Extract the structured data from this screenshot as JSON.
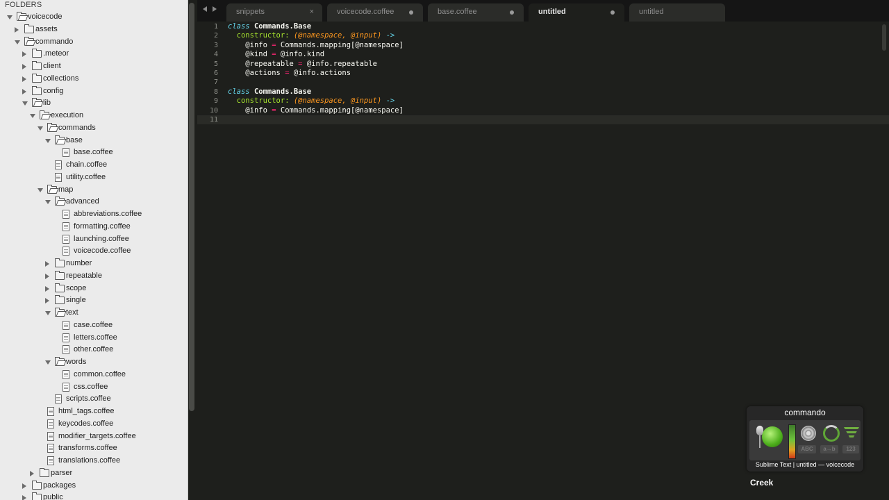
{
  "sidebar": {
    "header": "FOLDERS",
    "tree": [
      {
        "label": "voicecode",
        "depth": 0,
        "kind": "folder",
        "open": true
      },
      {
        "label": "assets",
        "depth": 1,
        "kind": "folder",
        "open": false
      },
      {
        "label": "commando",
        "depth": 1,
        "kind": "folder",
        "open": true
      },
      {
        "label": ".meteor",
        "depth": 2,
        "kind": "folder",
        "open": false
      },
      {
        "label": "client",
        "depth": 2,
        "kind": "folder",
        "open": false
      },
      {
        "label": "collections",
        "depth": 2,
        "kind": "folder",
        "open": false
      },
      {
        "label": "config",
        "depth": 2,
        "kind": "folder",
        "open": false
      },
      {
        "label": "lib",
        "depth": 2,
        "kind": "folder",
        "open": true
      },
      {
        "label": "execution",
        "depth": 3,
        "kind": "folder",
        "open": true
      },
      {
        "label": "commands",
        "depth": 4,
        "kind": "folder",
        "open": true
      },
      {
        "label": "base",
        "depth": 5,
        "kind": "folder",
        "open": true
      },
      {
        "label": "base.coffee",
        "depth": 6,
        "kind": "file"
      },
      {
        "label": "chain.coffee",
        "depth": 5,
        "kind": "file"
      },
      {
        "label": "utility.coffee",
        "depth": 5,
        "kind": "file"
      },
      {
        "label": "map",
        "depth": 4,
        "kind": "folder",
        "open": true
      },
      {
        "label": "advanced",
        "depth": 5,
        "kind": "folder",
        "open": true
      },
      {
        "label": "abbreviations.coffee",
        "depth": 6,
        "kind": "file"
      },
      {
        "label": "formatting.coffee",
        "depth": 6,
        "kind": "file"
      },
      {
        "label": "launching.coffee",
        "depth": 6,
        "kind": "file"
      },
      {
        "label": "voicecode.coffee",
        "depth": 6,
        "kind": "file"
      },
      {
        "label": "number",
        "depth": 5,
        "kind": "folder",
        "open": false
      },
      {
        "label": "repeatable",
        "depth": 5,
        "kind": "folder",
        "open": false
      },
      {
        "label": "scope",
        "depth": 5,
        "kind": "folder",
        "open": false
      },
      {
        "label": "single",
        "depth": 5,
        "kind": "folder",
        "open": false
      },
      {
        "label": "text",
        "depth": 5,
        "kind": "folder",
        "open": true
      },
      {
        "label": "case.coffee",
        "depth": 6,
        "kind": "file"
      },
      {
        "label": "letters.coffee",
        "depth": 6,
        "kind": "file"
      },
      {
        "label": "other.coffee",
        "depth": 6,
        "kind": "file"
      },
      {
        "label": "words",
        "depth": 5,
        "kind": "folder",
        "open": true
      },
      {
        "label": "common.coffee",
        "depth": 6,
        "kind": "file"
      },
      {
        "label": "css.coffee",
        "depth": 6,
        "kind": "file"
      },
      {
        "label": "scripts.coffee",
        "depth": 5,
        "kind": "file"
      },
      {
        "label": "html_tags.coffee",
        "depth": 4,
        "kind": "file"
      },
      {
        "label": "keycodes.coffee",
        "depth": 4,
        "kind": "file"
      },
      {
        "label": "modifier_targets.coffee",
        "depth": 4,
        "kind": "file"
      },
      {
        "label": "transforms.coffee",
        "depth": 4,
        "kind": "file"
      },
      {
        "label": "translations.coffee",
        "depth": 4,
        "kind": "file"
      },
      {
        "label": "parser",
        "depth": 3,
        "kind": "folder",
        "open": false
      },
      {
        "label": "packages",
        "depth": 2,
        "kind": "folder",
        "open": false
      },
      {
        "label": "public",
        "depth": 2,
        "kind": "folder",
        "open": false
      }
    ]
  },
  "tabs": [
    {
      "label": "snippets",
      "state": "close",
      "active": false
    },
    {
      "label": "voicecode.coffee",
      "state": "dirty",
      "active": false
    },
    {
      "label": "base.coffee",
      "state": "dirty",
      "active": false
    },
    {
      "label": "untitled",
      "state": "dirty",
      "active": true
    },
    {
      "label": "untitled",
      "state": "none",
      "active": false
    }
  ],
  "tab_close_glyph": "×",
  "editor": {
    "current_line": 11,
    "lines": [
      [
        {
          "t": "class",
          "c": "kw-class"
        },
        {
          "t": " "
        },
        {
          "t": "Commands.Base",
          "c": "cls"
        }
      ],
      [
        {
          "t": "  "
        },
        {
          "t": "constructor:",
          "c": "fn"
        },
        {
          "t": " "
        },
        {
          "t": "(@namespace, @input)",
          "c": "param"
        },
        {
          "t": " "
        },
        {
          "t": "->",
          "c": "arrow"
        }
      ],
      [
        {
          "t": "    "
        },
        {
          "t": "@info",
          "c": "ivar"
        },
        {
          "t": " "
        },
        {
          "t": "=",
          "c": "op"
        },
        {
          "t": " Commands.mapping[@namespace]"
        }
      ],
      [
        {
          "t": "    "
        },
        {
          "t": "@kind",
          "c": "ivar"
        },
        {
          "t": " "
        },
        {
          "t": "=",
          "c": "op"
        },
        {
          "t": " @info.kind"
        }
      ],
      [
        {
          "t": "    "
        },
        {
          "t": "@repeatable",
          "c": "ivar"
        },
        {
          "t": " "
        },
        {
          "t": "=",
          "c": "op"
        },
        {
          "t": " @info.repeatable"
        }
      ],
      [
        {
          "t": "    "
        },
        {
          "t": "@actions",
          "c": "ivar"
        },
        {
          "t": " "
        },
        {
          "t": "=",
          "c": "op"
        },
        {
          "t": " @info.actions"
        }
      ],
      [],
      [
        {
          "t": "class",
          "c": "kw-class"
        },
        {
          "t": " "
        },
        {
          "t": "Commands.Base",
          "c": "cls"
        }
      ],
      [
        {
          "t": "  "
        },
        {
          "t": "constructor:",
          "c": "fn"
        },
        {
          "t": " "
        },
        {
          "t": "(@namespace, @input)",
          "c": "param"
        },
        {
          "t": " "
        },
        {
          "t": "->",
          "c": "arrow"
        }
      ],
      [
        {
          "t": "    "
        },
        {
          "t": "@info",
          "c": "ivar"
        },
        {
          "t": " "
        },
        {
          "t": "=",
          "c": "op"
        },
        {
          "t": " Commands.mapping[@namespace]"
        }
      ],
      []
    ]
  },
  "hud": {
    "title": "commando",
    "badges": [
      "ABC",
      "a→b",
      "123"
    ],
    "status": "Sublime Text | untitled — voicecode",
    "footer": "Creek"
  }
}
